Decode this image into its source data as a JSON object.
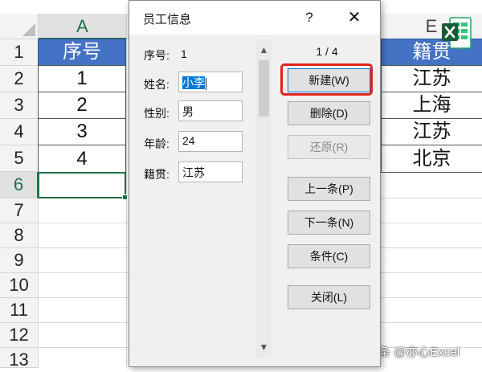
{
  "spreadsheet": {
    "col_headers": [
      "A",
      "E"
    ],
    "row_headers": [
      "1",
      "2",
      "3",
      "4",
      "5",
      "6",
      "7",
      "8",
      "9",
      "10",
      "11",
      "12",
      "13"
    ],
    "col_a": {
      "header": "序号",
      "values": [
        "1",
        "2",
        "3",
        "4"
      ]
    },
    "col_e": {
      "header": "籍贯",
      "values": [
        "江苏",
        "上海",
        "江苏",
        "北京"
      ]
    },
    "selected_cell": "A6"
  },
  "dialog": {
    "title": "员工信息",
    "help_label": "?",
    "close_label": "✕",
    "record_counter": "1 / 4",
    "fields": {
      "id_label": "序号:",
      "id_value": "1",
      "name_label": "姓名:",
      "name_value": "小李",
      "gender_label": "性别:",
      "gender_value": "男",
      "age_label": "年龄:",
      "age_value": "24",
      "origin_label": "籍贯:",
      "origin_value": "江苏"
    },
    "buttons": {
      "new": "新建(W)",
      "delete": "删除(D)",
      "restore": "还原(R)",
      "prev": "上一条(P)",
      "next": "下一条(N)",
      "criteria": "条件(C)",
      "close": "关闭(L)"
    },
    "scroll_up_icon": "▲",
    "scroll_down_icon": "▼"
  },
  "watermark": "头条 @亦心Excel",
  "colors": {
    "header_fill": "#4472c4",
    "excel_green": "#217346",
    "highlight_red": "#e3231b"
  },
  "icons": [
    "excel-logo-icon",
    "help-icon",
    "close-icon",
    "scroll-up-icon",
    "scroll-down-icon"
  ]
}
